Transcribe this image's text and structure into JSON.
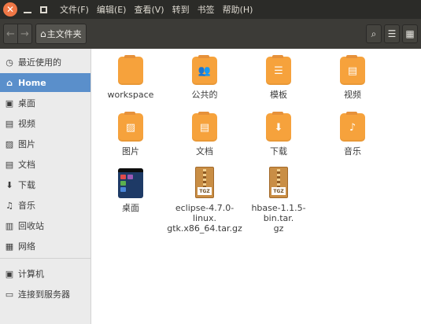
{
  "window": {
    "menus": [
      "文件(F)",
      "编辑(E)",
      "查看(V)",
      "转到",
      "书签",
      "帮助(H)"
    ]
  },
  "toolbar": {
    "breadcrumb": "主文件夹"
  },
  "sidebar": {
    "items": [
      {
        "label": "最近使用的",
        "icon": "clock-icon"
      },
      {
        "label": "Home",
        "icon": "home-icon"
      },
      {
        "label": "桌面",
        "icon": "desktop-icon"
      },
      {
        "label": "视频",
        "icon": "film-icon"
      },
      {
        "label": "图片",
        "icon": "image-icon"
      },
      {
        "label": "文档",
        "icon": "document-icon"
      },
      {
        "label": "下载",
        "icon": "download-icon"
      },
      {
        "label": "音乐",
        "icon": "music-icon"
      },
      {
        "label": "回收站",
        "icon": "trash-icon"
      },
      {
        "label": "网络",
        "icon": "network-icon"
      },
      {
        "label": "计算机",
        "icon": "computer-icon"
      },
      {
        "label": "连接到服务器",
        "icon": "server-icon"
      }
    ],
    "active": "Home"
  },
  "files": [
    {
      "name": "workspace",
      "type": "folder"
    },
    {
      "name": "公共的",
      "type": "folder"
    },
    {
      "name": "模板",
      "type": "folder"
    },
    {
      "name": "视频",
      "type": "folder"
    },
    {
      "name": "图片",
      "type": "folder"
    },
    {
      "name": "文档",
      "type": "folder"
    },
    {
      "name": "下载",
      "type": "folder"
    },
    {
      "name": "音乐",
      "type": "folder"
    },
    {
      "name": "桌面",
      "type": "folder"
    },
    {
      "name": "eclipse-4.7.0-linux.\ngtk.x86_64.tar.gz",
      "type": "archive",
      "badge": "TGZ"
    },
    {
      "name": "hbase-1.1.5-bin.tar.\ngz",
      "type": "archive",
      "badge": "TGZ"
    }
  ],
  "colors": {
    "folder": "#f6a23c",
    "selection": "#5a8fcb",
    "menubar": "#2b2b28",
    "toolbar": "#3c3b37",
    "close": "#f07746"
  }
}
